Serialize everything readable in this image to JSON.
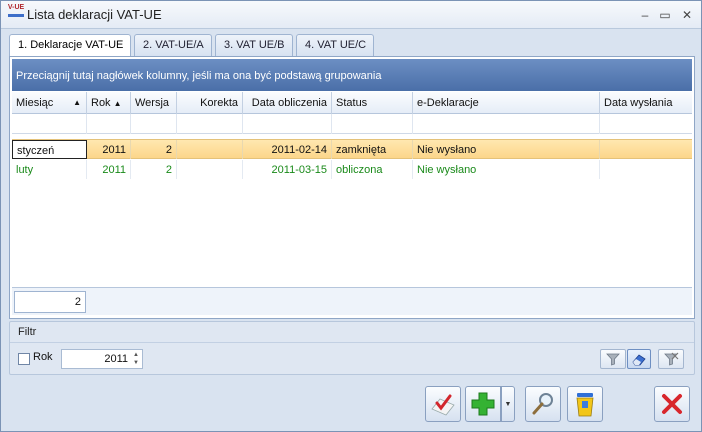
{
  "window": {
    "title": "Lista deklaracji VAT-UE",
    "icon_text": "V-UE",
    "minimize": "–",
    "maximize": "▭",
    "close": "✕"
  },
  "tabs": [
    {
      "label": "1. Deklaracje VAT-UE",
      "active": true
    },
    {
      "label": "2. VAT-UE/A"
    },
    {
      "label": "3. VAT UE/B"
    },
    {
      "label": "4. VAT UE/C"
    }
  ],
  "grid": {
    "group_hint": "Przeciągnij tutaj nagłówek kolumny, jeśli ma ona być podstawą grupowania",
    "columns": [
      "Miesiąc",
      "Rok",
      "Wersja",
      "Korekta",
      "Data obliczenia",
      "Status",
      "e-Deklaracje",
      "Data wysłania"
    ],
    "sort_arrow": "▲",
    "rows": [
      {
        "miesiac": "styczeń",
        "rok": "2011",
        "wersja": "2",
        "korekta": "",
        "data_obliczenia": "2011-02-14",
        "status": "zamknięta",
        "edeklaracje": "Nie wysłano",
        "data_wyslania": ""
      },
      {
        "miesiac": "luty",
        "rok": "2011",
        "wersja": "2",
        "korekta": "",
        "data_obliczenia": "2011-03-15",
        "status": "obliczona",
        "edeklaracje": "Nie wysłano",
        "data_wyslania": ""
      }
    ],
    "count": "2"
  },
  "filter": {
    "title": "Filtr",
    "rok_label": "Rok",
    "rok_checked": false,
    "rok_value": "2011",
    "spin_up": "▲",
    "spin_down": "▼"
  },
  "colors": {
    "selected_row": "#fcd68a",
    "green_text": "#1a8a1a",
    "group_bar": "#4a6fa8"
  }
}
